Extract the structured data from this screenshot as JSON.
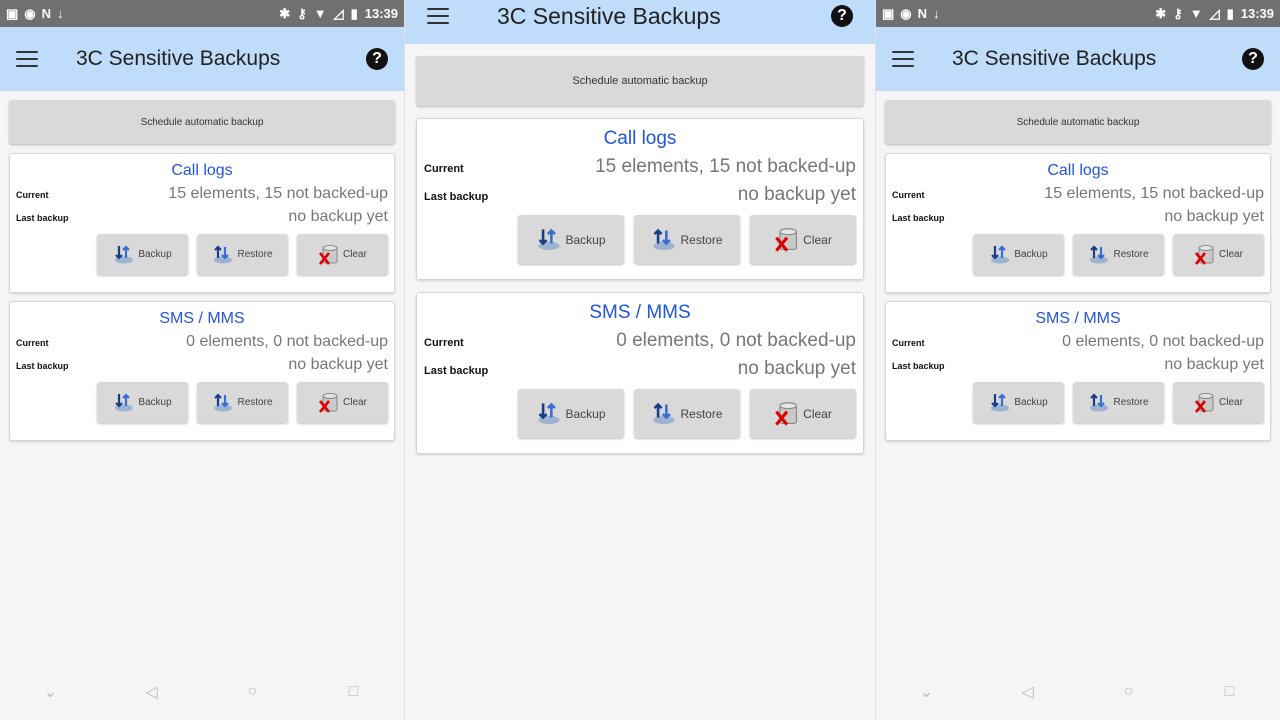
{
  "status_bar": {
    "time": "13:39"
  },
  "app": {
    "title": "3C Sensitive Backups"
  },
  "schedule_label": "Schedule automatic backup",
  "cards": [
    {
      "title": "Call logs",
      "current_label": "Current",
      "current_value": "15 elements, 15 not backed-up",
      "last_label": "Last backup",
      "last_value": "no backup yet"
    },
    {
      "title": "SMS / MMS",
      "current_label": "Current",
      "current_value": "0 elements, 0 not backed-up",
      "last_label": "Last backup",
      "last_value": "no backup yet"
    }
  ],
  "buttons": {
    "backup": "Backup",
    "restore": "Restore",
    "clear": "Clear"
  },
  "icons": {
    "menu": "hamburger-menu-icon",
    "help": "help-circle-icon",
    "backup": "backup-arrows-icon",
    "restore": "restore-arrows-icon",
    "clear": "database-delete-icon"
  },
  "colors": {
    "appbar": "#bfdcfa",
    "title_accent": "#2255dd",
    "status_bar": "#707070"
  }
}
